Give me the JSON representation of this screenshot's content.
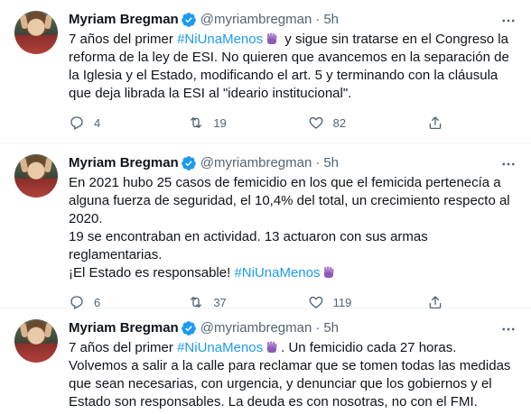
{
  "colors": {
    "link": "#1d9bf0",
    "text": "#0f1419",
    "muted": "#536471",
    "verified": "#1d9bf0",
    "border": "#eff3f4"
  },
  "icons": {
    "verified": "verified-badge-icon",
    "reply": "reply-icon",
    "retweet": "retweet-icon",
    "like": "heart-icon",
    "share": "share-icon",
    "more": "more-icon",
    "emoji": "purple-fist-emoji"
  },
  "tweets": [
    {
      "author": {
        "name": "Myriam Bregman",
        "handle": "@myriambregman"
      },
      "separator": "·",
      "time": "5h",
      "text": {
        "p1_a": "7 años del primer ",
        "p1_hashtag": "#NiUnaMenos",
        "p1_b": " y sigue sin tratarse en el Congreso la reforma de la ley de ESI. No quieren que avancemos en la separación de la Iglesia y el Estado, modificando el art. 5 y terminando con la cláusula que deja librada la ESI al \"ideario institucional\"."
      },
      "stats": {
        "replies": "4",
        "retweets": "19",
        "likes": "82"
      }
    },
    {
      "author": {
        "name": "Myriam Bregman",
        "handle": "@myriambregman"
      },
      "separator": "·",
      "time": "5h",
      "text": {
        "p1": "En 2021 hubo 25 casos de femicidio en los que el femicida pertenecía a alguna fuerza de seguridad, el 10,4% del total, un crecimiento respecto al 2020.",
        "p2": "19 se encontraban en actividad. 13 actuaron con sus armas reglamentarias.",
        "p3_a": "¡El Estado es responsable! ",
        "p3_hashtag": "#NiUnaMenos"
      },
      "stats": {
        "replies": "6",
        "retweets": "37",
        "likes": "119"
      }
    },
    {
      "author": {
        "name": "Myriam Bregman",
        "handle": "@myriambregman"
      },
      "separator": "·",
      "time": "5h",
      "text": {
        "p1_a": "7 años del primer ",
        "p1_hashtag": "#NiUnaMenos",
        "p1_b": ". Un femicidio cada 27 horas. Volvemos a salir a la calle para reclamar que se tomen todas las medidas que sean necesarias, con urgencia, y denunciar que los gobiernos y el Estado son responsables. La deuda es con nosotras, no con el FMI."
      }
    }
  ]
}
